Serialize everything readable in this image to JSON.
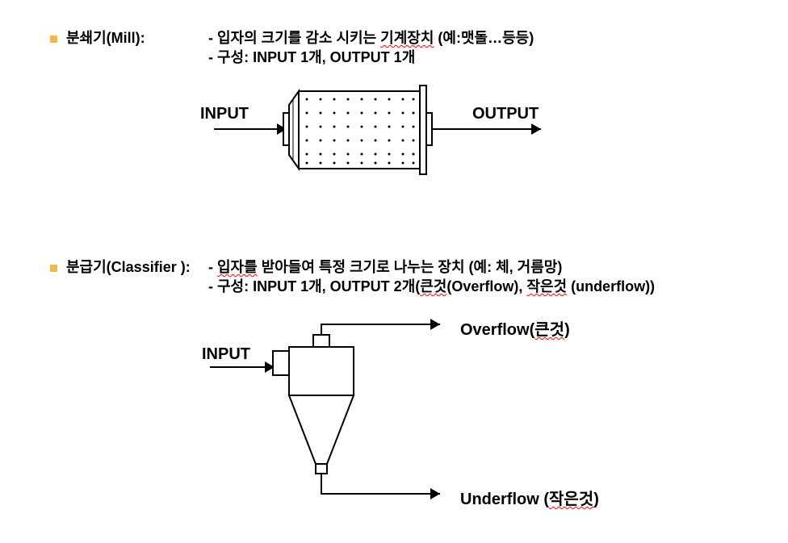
{
  "mill": {
    "title": "분쇄기(Mill):",
    "desc1_prefix": "- 입자의 크기를 감소 시키는 ",
    "desc1_hl": "기계장치",
    "desc1_suffix": " (예:맷돌…등등)",
    "desc2": "- 구성: INPUT 1개, OUTPUT 1개",
    "input_label": "INPUT",
    "output_label": "OUTPUT"
  },
  "classifier": {
    "title": "분급기(Classifier ):",
    "desc1_prefix": "- ",
    "desc1_hl": "입자를",
    "desc1_mid": " 받아들여 특정 크기로 나누는 장치 (예: 체, 거름망)",
    "desc2_prefix": "- 구성: INPUT 1개, OUTPUT 2개(",
    "desc2_hl1": "큰것",
    "desc2_mid": "(Overflow), ",
    "desc2_hl2": "작은것",
    "desc2_suffix": " (underflow))",
    "input_label": "INPUT",
    "overflow_prefix": "Overflow(",
    "overflow_hl": "큰것",
    "overflow_suffix": ")",
    "underflow_prefix": "Underflow (",
    "underflow_hl": "작은것",
    "underflow_suffix": ")"
  }
}
